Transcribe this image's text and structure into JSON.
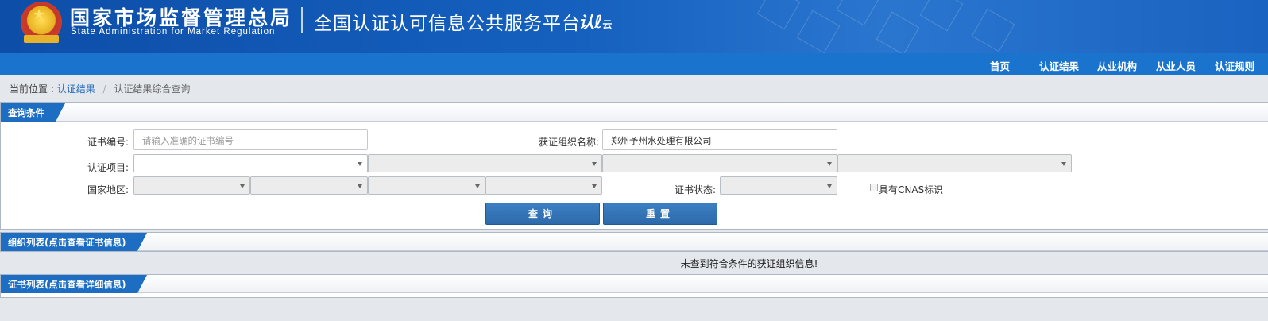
{
  "header": {
    "agency_cn": "国家市场监督管理总局",
    "agency_en": "State Administration  for  Market Regulation",
    "platform_title": "全国认证认可信息公共服务平台",
    "logo_text_main": "认",
    "logo_text_sub": "云"
  },
  "nav": {
    "items": [
      {
        "label": "首页"
      },
      {
        "label": "认证结果"
      },
      {
        "label": "从业机构"
      },
      {
        "label": "从业人员"
      },
      {
        "label": "认证规则"
      }
    ]
  },
  "breadcrumb": {
    "prefix": "当前位置 :",
    "link": "认证结果",
    "separator": "/",
    "current": "认证结果综合查询"
  },
  "query_panel": {
    "title": "查询条件",
    "cert_no_label": "证书编号:",
    "cert_no_placeholder": "请输入准确的证书编号",
    "org_name_label": "获证组织名称:",
    "org_name_value": "郑州予州水处理有限公司",
    "cert_project_label": "认证项目:",
    "region_label": "国家地区:",
    "cert_status_label": "证书状态:",
    "cnas_label": "具有CNAS标识",
    "query_button": "查询",
    "reset_button": "重置"
  },
  "org_list_panel": {
    "title": "组织列表(点击查看证书信息)",
    "empty_message": "未查到符合条件的获证组织信息!"
  },
  "cert_list_panel": {
    "title": "证书列表(点击查看详细信息)"
  },
  "colors": {
    "header_blue": "#1560be",
    "nav_blue": "#1a73cc",
    "tab_blue": "#1d6ec3",
    "button_blue": "#3478bb",
    "link_blue": "#2a6fbf",
    "page_bg": "#e4e7eb"
  }
}
